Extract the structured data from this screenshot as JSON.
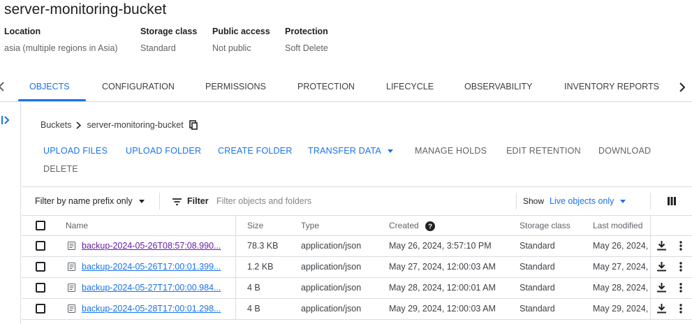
{
  "bucket": {
    "title": "server-monitoring-bucket",
    "meta": [
      {
        "label": "Location",
        "value": "asia (multiple regions in Asia)"
      },
      {
        "label": "Storage class",
        "value": "Standard"
      },
      {
        "label": "Public access",
        "value": "Not public"
      },
      {
        "label": "Protection",
        "value": "Soft Delete"
      }
    ]
  },
  "tabs": [
    {
      "label": "OBJECTS",
      "active": true
    },
    {
      "label": "CONFIGURATION"
    },
    {
      "label": "PERMISSIONS"
    },
    {
      "label": "PROTECTION"
    },
    {
      "label": "LIFECYCLE"
    },
    {
      "label": "OBSERVABILITY"
    },
    {
      "label": "INVENTORY REPORTS"
    }
  ],
  "breadcrumb": {
    "root": "Buckets",
    "current": "server-monitoring-bucket"
  },
  "actions": {
    "upload_files": "UPLOAD FILES",
    "upload_folder": "UPLOAD FOLDER",
    "create_folder": "CREATE FOLDER",
    "transfer_data": "TRANSFER DATA",
    "manage_holds": "MANAGE HOLDS",
    "edit_retention": "EDIT RETENTION",
    "download": "DOWNLOAD",
    "delete": "DELETE"
  },
  "filter": {
    "mode": "Filter by name prefix only",
    "label": "Filter",
    "placeholder": "Filter objects and folders",
    "show_label": "Show",
    "show_value": "Live objects only"
  },
  "table": {
    "headers": {
      "name": "Name",
      "size": "Size",
      "type": "Type",
      "created": "Created",
      "storage_class": "Storage class",
      "last_modified": "Last modified"
    },
    "rows": [
      {
        "name": "backup-2024-05-26T08:57:08.990...",
        "size": "78.3 KB",
        "type": "application/json",
        "created": "May 26, 2024, 3:57:10 PM",
        "storage_class": "Standard",
        "last_modified": "May 26, 2024,"
      },
      {
        "name": "backup-2024-05-26T17:00:01.399...",
        "size": "1.2 KB",
        "type": "application/json",
        "created": "May 27, 2024, 12:00:03 AM",
        "storage_class": "Standard",
        "last_modified": "May 27, 2024,"
      },
      {
        "name": "backup-2024-05-27T17:00:00.984...",
        "size": "4 B",
        "type": "application/json",
        "created": "May 28, 2024, 12:00:01 AM",
        "storage_class": "Standard",
        "last_modified": "May 28, 2024,"
      },
      {
        "name": "backup-2024-05-28T17:00:01.298...",
        "size": "4 B",
        "type": "application/json",
        "created": "May 29, 2024, 12:00:03 AM",
        "storage_class": "Standard",
        "last_modified": "May 29, 2024,"
      }
    ]
  },
  "colors": {
    "accent": "#1a73e8",
    "visited_link": "#681da8",
    "border": "#dadce0",
    "muted_text": "#5f6368"
  },
  "icons": [
    "chevron-left-icon",
    "chevron-right-icon",
    "expand-panel-icon",
    "copy-icon",
    "filter-icon",
    "help-icon",
    "column-display-icon",
    "file-icon",
    "download-icon",
    "more-vert-icon"
  ]
}
